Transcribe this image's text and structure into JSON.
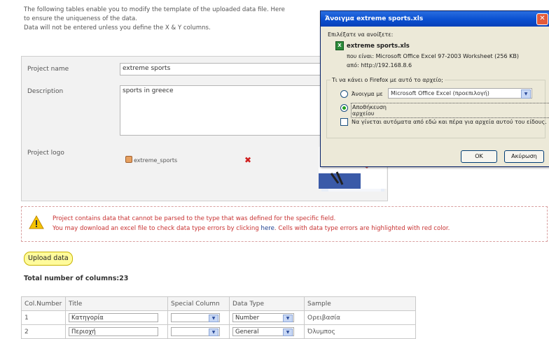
{
  "intro": {
    "line1": "The following tables enable you to modify the template of the uploaded data file. Here",
    "line2": "to ensure the uniqueness of the data.",
    "line3": "Data will not be entered unless you define the X & Y columns."
  },
  "project": {
    "name_label": "Project name",
    "name_value": "extreme sports",
    "description_label": "Description",
    "description_value": "sports in greece",
    "logo_label": "Project logo",
    "logo_file": "extreme_sports"
  },
  "warning": {
    "line1": "Project contains data that cannot be parsed to the type that was defined for the specific field.",
    "line2_before": "You may download an excel file to check data type errors by clicking ",
    "link": "here",
    "line2_after": ". Cells with data type errors are highlighted with red color."
  },
  "upload_label": "Upload data",
  "total_label": "Total number of columns:23",
  "columns_table": {
    "headers": [
      "Col.Number",
      "Title",
      "Special Column",
      "Data Type",
      "Sample"
    ],
    "rows": [
      {
        "num": "1",
        "title": "Κατηγορία",
        "special": "",
        "type": "Number",
        "sample": "Ορειβασία"
      },
      {
        "num": "2",
        "title": "Περιοχή",
        "special": "",
        "type": "General",
        "sample": "Όλυμπος"
      }
    ]
  },
  "dialog": {
    "title": "Άνοιγμα extreme sports.xls",
    "choose_label": "Επιλέξατε να ανοίξετε:",
    "file_name": "extreme sports.xls",
    "type_line": "που είναι:  Microsoft Office Excel 97-2003 Worksheet (256 KB)",
    "from_line": "από:  http://192.168.8.6",
    "question": "Τι να κάνει ο Firefox  με αυτό το αρχείο;",
    "open_with_label": "Άνοιγμα με",
    "open_with_value": "Microsoft Office Excel (προεπιλογή)",
    "save_label": "Αποθήκευση αρχείου",
    "auto_label": "Να γίνεται αυτόματα από εδώ και πέρα για αρχεία αυτού του είδους.",
    "ok_label": "OK",
    "cancel_label": "Ακύρωση"
  }
}
